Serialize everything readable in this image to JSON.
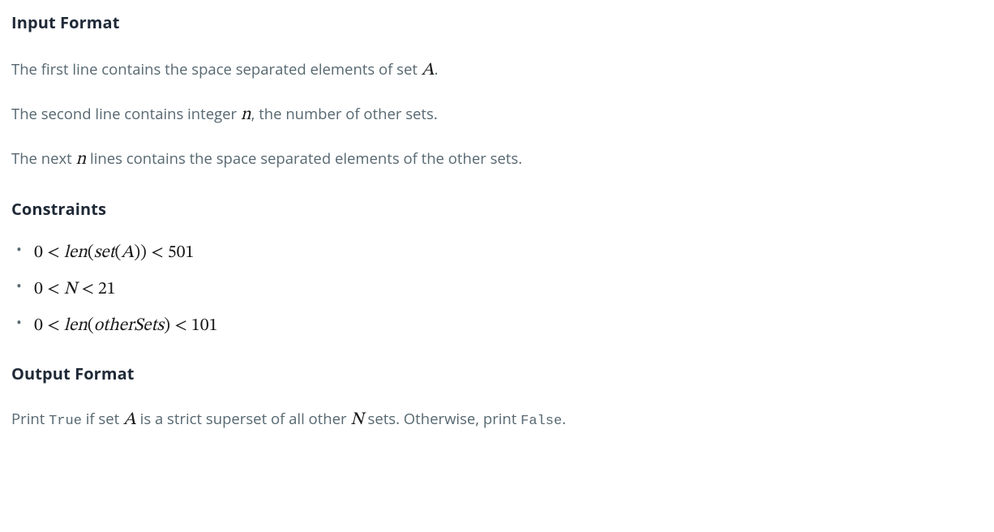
{
  "headings": {
    "input_format": "Input Format",
    "constraints": "Constraints",
    "output_format": "Output Format"
  },
  "input_lines": {
    "line1_pre": "The first line contains the space separated elements of set ",
    "line1_var": "A",
    "line1_post": ".",
    "line2_pre": "The second line contains integer ",
    "line2_var": "n",
    "line2_post": ", the number of other sets.",
    "line3_pre": "The next ",
    "line3_var": "n",
    "line3_post": " lines contains the space separated elements of the other sets."
  },
  "constraints_items": {
    "c1": {
      "lhs": "0",
      "lt1": "<",
      "func": "len",
      "paren_open": "(",
      "inner_func": "set",
      "inner_paren_open": "(",
      "var": "A",
      "inner_paren_close": ")",
      "paren_close": ")",
      "lt2": "<",
      "rhs": "501"
    },
    "c2": {
      "lhs": "0",
      "lt1": "<",
      "var": "N",
      "lt2": "<",
      "rhs": "21"
    },
    "c3": {
      "lhs": "0",
      "lt1": "<",
      "func": "len",
      "paren_open": "(",
      "var": "otherSets",
      "paren_close": ")",
      "lt2": "<",
      "rhs": "101"
    }
  },
  "output_line": {
    "pre": "Print ",
    "code1": "True",
    "mid1": " if set ",
    "var1": "A",
    "mid2": " is a strict superset of all other ",
    "var2": "N",
    "mid3": " sets. Otherwise, print ",
    "code2": "False",
    "post": "."
  }
}
